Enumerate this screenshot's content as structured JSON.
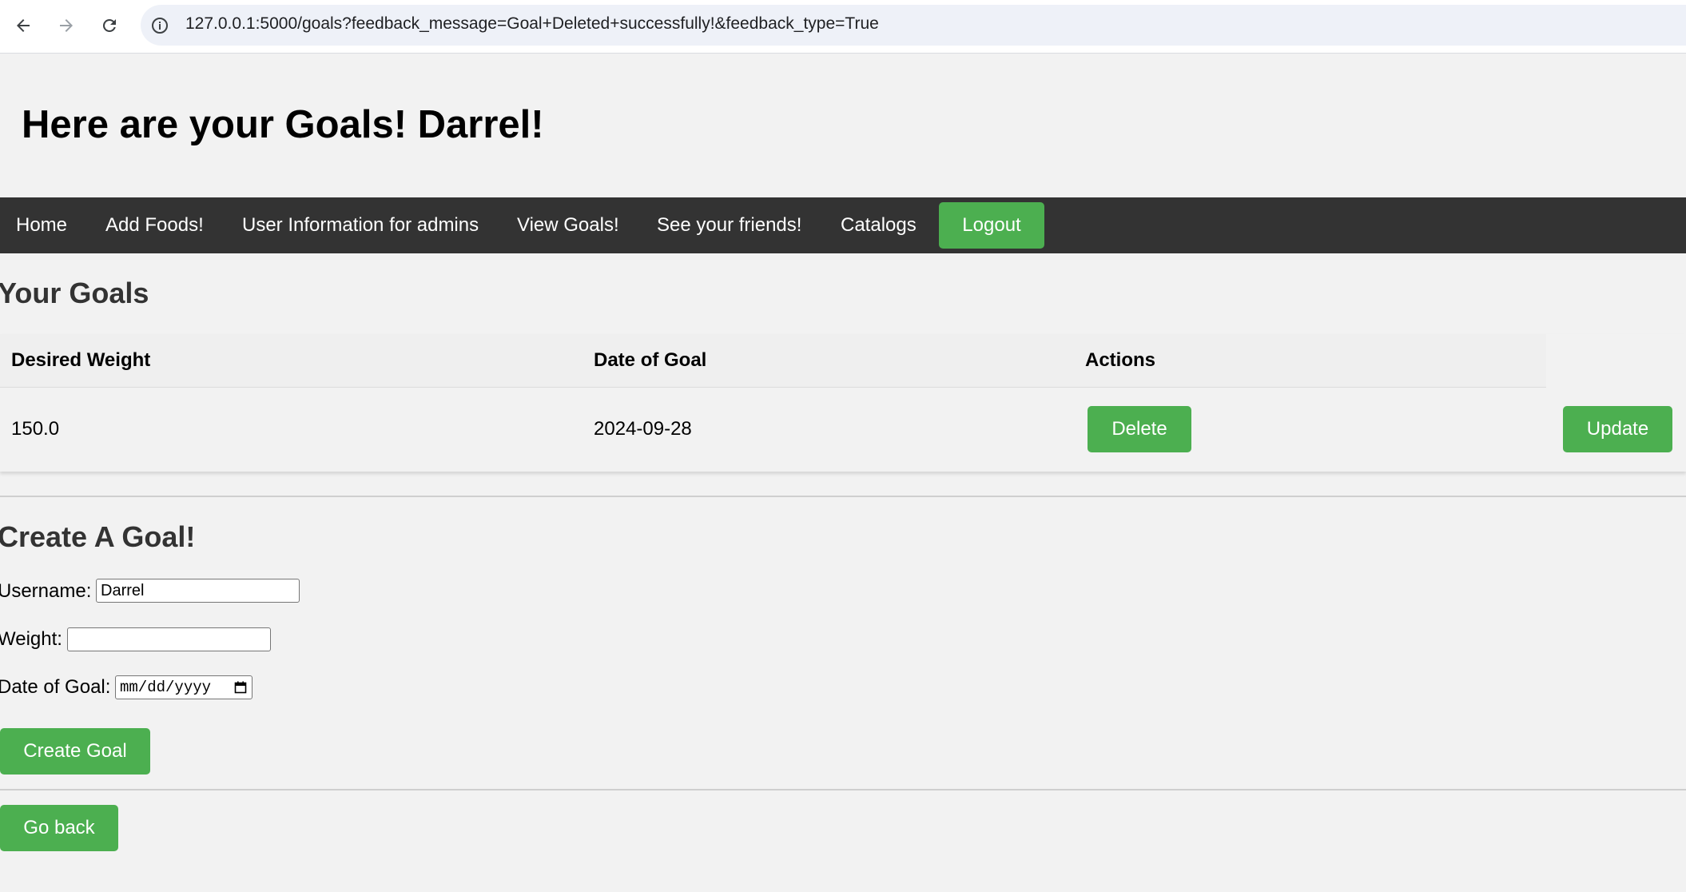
{
  "browser": {
    "url": "127.0.0.1:5000/goals?feedback_message=Goal+Deleted+successfully!&feedback_type=True"
  },
  "page": {
    "title": "Here are your Goals! Darrel!"
  },
  "nav": {
    "items": [
      "Home",
      "Add Foods!",
      "User Information for admins",
      "View Goals!",
      "See your friends!",
      "Catalogs"
    ],
    "logout": "Logout"
  },
  "goals": {
    "heading": "Your Goals",
    "columns": [
      "Desired Weight",
      "Date of Goal",
      "Actions"
    ],
    "rows": [
      {
        "weight": "150.0",
        "date": "2024-09-28",
        "delete_label": "Delete",
        "update_label": "Update"
      }
    ]
  },
  "create_form": {
    "heading": "Create A Goal!",
    "username_label": "Username:",
    "username_value": "Darrel",
    "weight_label": "Weight:",
    "weight_value": "",
    "date_label": "Date of Goal:",
    "date_placeholder": "mm/dd/yyyy",
    "submit_label": "Create Goal"
  },
  "footer": {
    "back_label": "Go back"
  },
  "colors": {
    "accent": "#4caf50",
    "navbar": "#333333",
    "background": "#f2f2f2"
  }
}
